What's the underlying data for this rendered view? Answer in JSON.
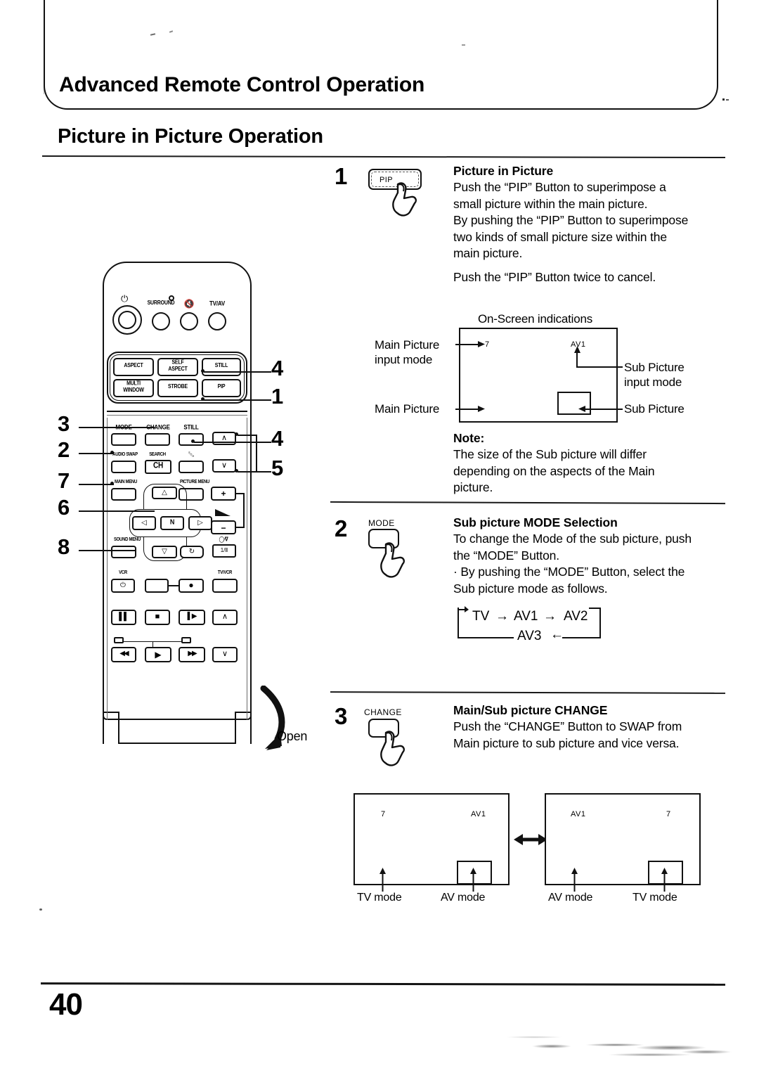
{
  "header": {
    "banner_title": "Advanced Remote Control Operation",
    "section_title": "Picture in Picture Operation"
  },
  "footer": {
    "page_number": "40"
  },
  "remote": {
    "open_label": "Open",
    "callouts": [
      "3",
      "2",
      "7",
      "6",
      "8",
      "4",
      "1",
      "4",
      "5"
    ],
    "top_row_labels": [
      "SURROUND",
      "TV/AV"
    ],
    "aspect_keys": [
      "ASPECT",
      "SELF\nASPECT",
      "STILL",
      "MULTI\nWINDOW",
      "STROBE",
      "PIP"
    ],
    "flap_keys": [
      "MODE",
      "CHANGE",
      "STILL",
      "AUDIO SWAP",
      "SEARCH",
      "CH",
      "MAIN MENU",
      "PICTURE MENU",
      "N",
      "SOUND MENU",
      "VCR",
      "TV/VCR"
    ],
    "glyphs": {
      "power": "⏻",
      "mute": "mute-icon",
      "up": "∧",
      "down": "∨",
      "plus": "+",
      "minus": "−",
      "left": "◁",
      "right": "▷",
      "arrow_up": "△",
      "arrow_down": "▽",
      "timer": "↻",
      "audio": "1/Ⅱ",
      "audio_label": "◯∕∇",
      "pause": "▐▌",
      "stop": "■",
      "slow": "▐▶",
      "rewind": "◀◀",
      "play": "▶",
      "forward": "▶▶",
      "record": "●"
    }
  },
  "steps": [
    {
      "number": "1",
      "key_label": "PIP",
      "heading": "Picture in Picture",
      "body": "Push the “PIP” Button to superimpose a\nsmall picture within the main picture.\nBy pushing the “PIP” Button to superimpose\ntwo kinds of small picture size within the\nmain picture.",
      "body2": "Push the “PIP” Button twice to cancel."
    },
    {
      "number": "2",
      "key_label": "MODE",
      "heading": "Sub picture MODE Selection",
      "body": "To change the Mode of the sub picture, push\nthe “MODE” Button.\n· By pushing the “MODE” Button, select the\nSub picture mode as follows."
    },
    {
      "number": "3",
      "key_label": "CHANGE",
      "heading": "Main/Sub picture CHANGE",
      "body": "Push the “CHANGE” Button to SWAP from\nMain picture to sub picture and vice versa."
    }
  ],
  "onscreen_diagram": {
    "caption": "On-Screen indications",
    "main_osd": "7",
    "sub_osd": "AV1",
    "labels": {
      "main_input": "Main Picture\ninput mode",
      "main_picture": "Main Picture",
      "sub_input": "Sub Picture\ninput mode",
      "sub_picture": "Sub Picture"
    }
  },
  "note": {
    "heading": "Note:",
    "body": "The size of the Sub picture will differ\ndepending on the aspects of the Main\npicture."
  },
  "mode_cycle": {
    "items": [
      "TV",
      "AV1",
      "AV2",
      "AV3"
    ],
    "arrow": "→",
    "arrow_left": "←"
  },
  "swap_diagram": {
    "left": {
      "main_osd": "7",
      "sub_osd": "AV1",
      "main_label": "TV mode",
      "sub_label": "AV mode"
    },
    "right": {
      "main_osd": "AV1",
      "sub_osd": "7",
      "main_label": "AV mode",
      "sub_label": "TV mode"
    },
    "swap_icon": "double-arrow-icon"
  },
  "colors": {
    "ink": "#111111",
    "paper": "#ffffff"
  }
}
